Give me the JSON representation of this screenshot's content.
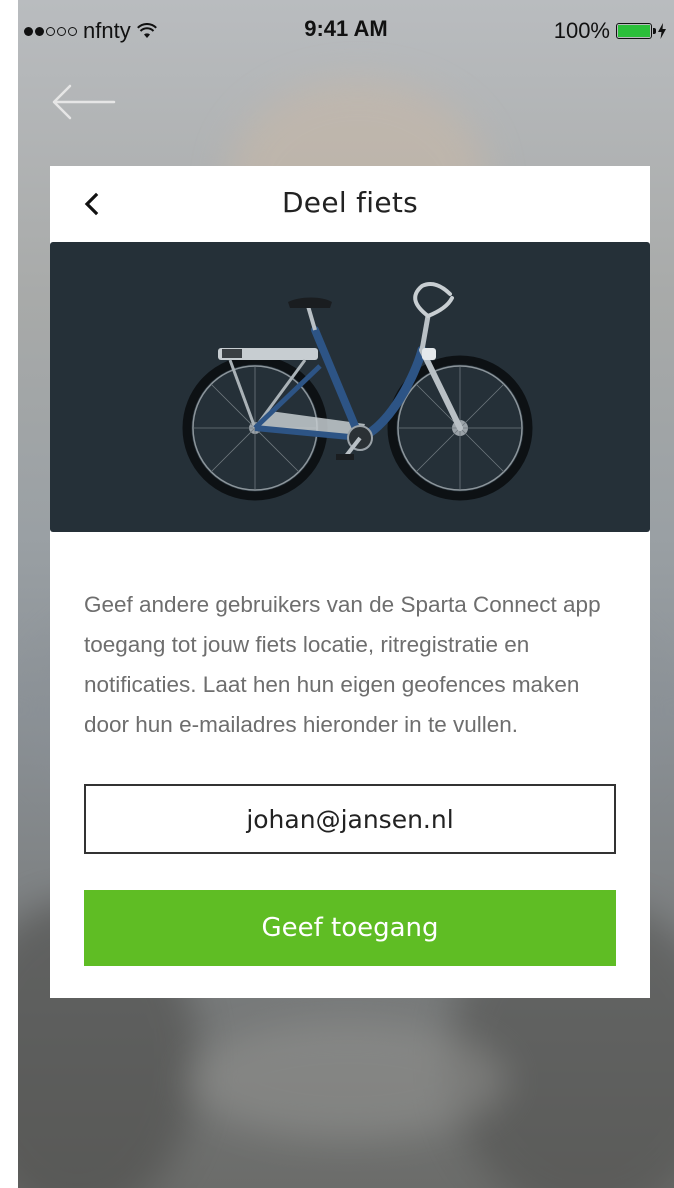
{
  "status_bar": {
    "carrier": "nfnty",
    "time": "9:41 AM",
    "battery": "100%",
    "wifi_icon": "wifi-icon",
    "battery_icon": "battery-icon",
    "signal": {
      "filled": 2,
      "total": 5
    }
  },
  "background": {
    "back_icon": "arrow-left-icon"
  },
  "dialog": {
    "title": "Deel fiets",
    "back_icon": "chevron-left-icon",
    "image": "bike-image",
    "description": "Geef andere gebruikers van de Sparta Connect app toegang tot jouw fiets locatie, ritregistratie en notificaties. Laat hen hun eigen geofences maken door hun e-mailadres hieronder in te vullen.",
    "email_value": "johan@jansen.nl",
    "submit_label": "Geef toegang"
  },
  "colors": {
    "accent": "#5fbd24",
    "image_background": "#253038",
    "text_muted": "#6e6e6e"
  }
}
